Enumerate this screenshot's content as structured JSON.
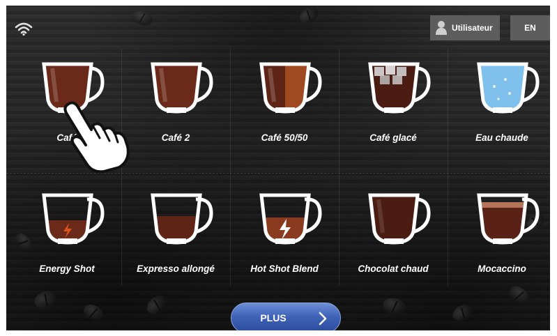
{
  "header": {
    "user_label": "Utilisateur",
    "language_label": "EN"
  },
  "drinks": [
    {
      "name": "Café 1",
      "visible_label": "Café",
      "liquid": "#6b2a19",
      "fill": 0.78
    },
    {
      "name": "Café 2",
      "visible_label": "Café 2",
      "liquid": "#6b2a19",
      "fill": 0.78
    },
    {
      "name": "Café 50/50",
      "visible_label": "Café 50/50",
      "liquid": "#8a3a1e",
      "fill": 0.78
    },
    {
      "name": "Café glacé",
      "visible_label": "Café glacé",
      "liquid": "#4a1c12",
      "fill": 0.78
    },
    {
      "name": "Eau chaude",
      "visible_label": "Eau chaude",
      "liquid": "#7fc0ec",
      "fill": 0.82
    },
    {
      "name": "Energy Shot",
      "visible_label": "Energy Shot",
      "liquid": "#6b2a19",
      "fill": 0.35
    },
    {
      "name": "Expresso allongé",
      "visible_label": "Expresso allongé",
      "liquid": "#5e2416",
      "fill": 0.45
    },
    {
      "name": "Hot Shot Blend",
      "visible_label": "Hot Shot Blend",
      "liquid": "#8a3a1e",
      "fill": 0.42
    },
    {
      "name": "Chocolat chaud",
      "visible_label": "Chocolat chaud",
      "liquid": "#4a1c12",
      "fill": 0.78
    },
    {
      "name": "Mocaccino",
      "visible_label": "Mocaccino",
      "liquid": "#5a2216",
      "fill": 0.72
    }
  ],
  "footer": {
    "plus_label": "PLUS"
  },
  "icons": {
    "wifi": "wifi-icon",
    "user": "user-icon",
    "chevron": "chevron-right-icon",
    "pointer": "hand-pointer-icon"
  },
  "colors": {
    "accent": "#3f63b8",
    "button_gray": "#5d5d5d"
  }
}
